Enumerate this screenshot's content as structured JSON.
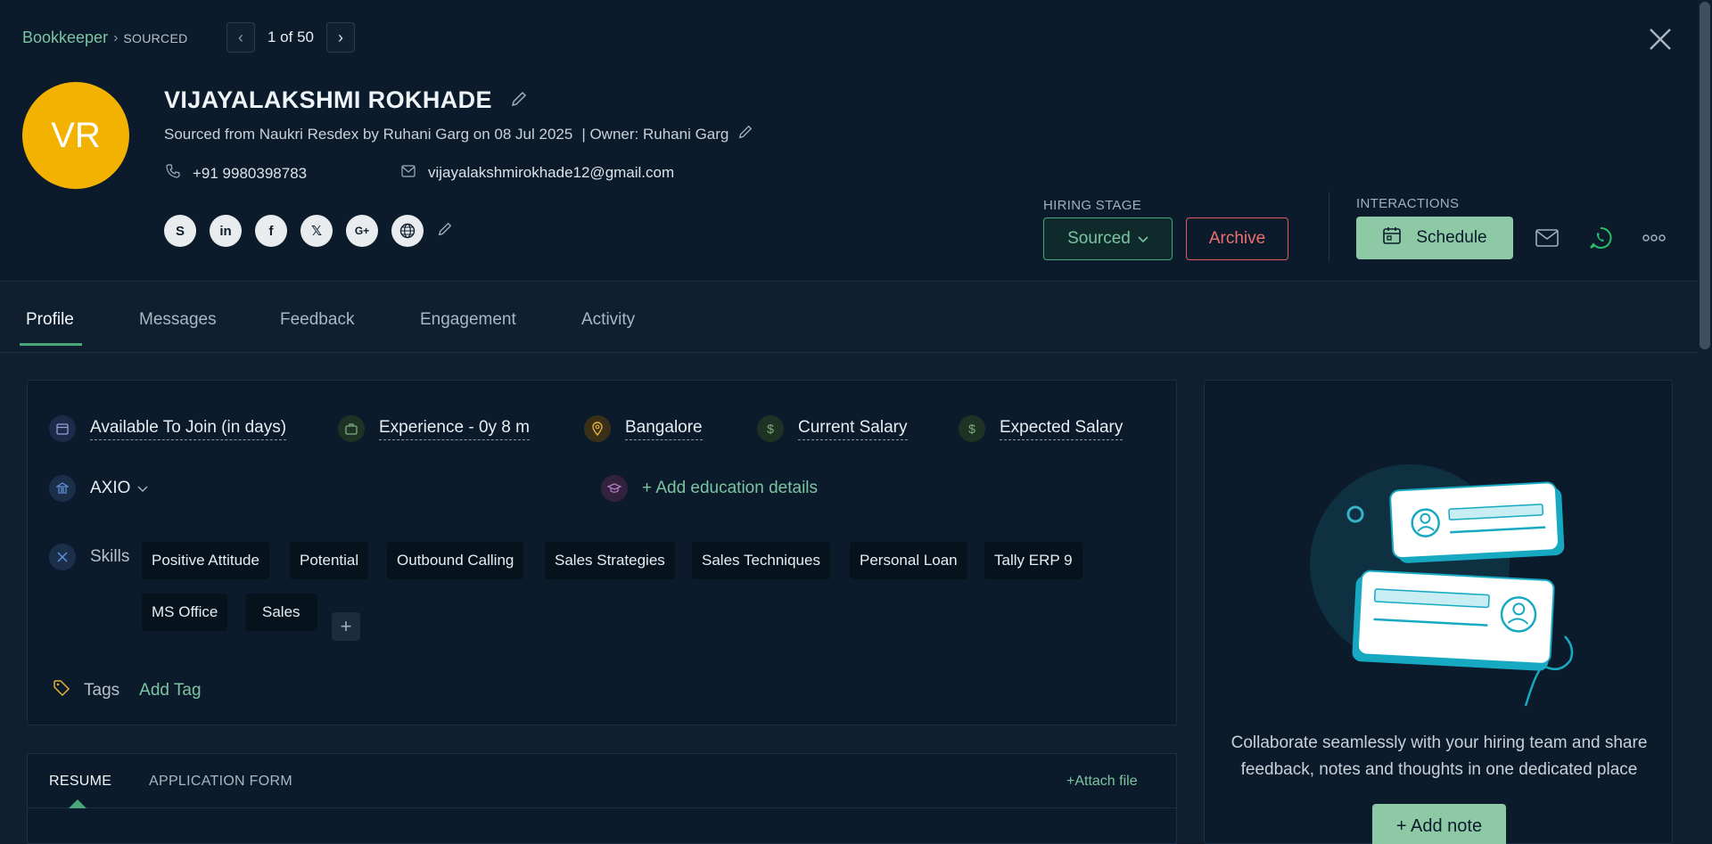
{
  "breadcrumb": {
    "parent": "Bookkeeper",
    "current": "SOURCED"
  },
  "pager": {
    "text": "1 of 50"
  },
  "candidate": {
    "initials": "VR",
    "name": "VIJAYALAKSHMI ROKHADE",
    "source_line": "Sourced from Naukri Resdex by Ruhani Garg on 08 Jul 2025",
    "owner_line": "| Owner: Ruhani Garg",
    "phone": "+91 9980398783",
    "email": "vijayalakshmirokhade12@gmail.com"
  },
  "socials": [
    "skype-icon",
    "linkedin-icon",
    "facebook-icon",
    "x-icon",
    "google-plus-icon",
    "website-icon"
  ],
  "hiring": {
    "label": "HIRING STAGE",
    "stage": "Sourced",
    "archive": "Archive"
  },
  "interactions": {
    "label": "INTERACTIONS",
    "schedule": "Schedule"
  },
  "tabs": [
    "Profile",
    "Messages",
    "Feedback",
    "Engagement",
    "Activity"
  ],
  "profile": {
    "available": "Available To Join (in days)",
    "experience": "Experience - 0y 8 m",
    "location": "Bangalore",
    "current_salary": "Current Salary",
    "expected_salary": "Expected Salary",
    "company": "AXIO",
    "education": "+ Add education details",
    "skills_label": "Skills",
    "skills": [
      "Positive Attitude",
      "Potential",
      "Outbound Calling",
      "Sales Strategies",
      "Sales Techniques",
      "Personal Loan",
      "Tally ERP 9",
      "MS Office",
      "Sales"
    ],
    "tags_label": "Tags",
    "add_tag": "Add Tag"
  },
  "resume": {
    "tab_resume": "RESUME",
    "tab_form": "APPLICATION FORM",
    "attach": "+Attach file"
  },
  "side": {
    "text": "Collaborate seamlessly with your hiring team and share feedback, notes and thoughts in one dedicated place",
    "add_note": "+ Add note"
  },
  "colors": {
    "accent": "#7cc4a1",
    "avatar": "#f3b200",
    "archive": "#e05d5d",
    "bg": "#0b1b2b"
  }
}
